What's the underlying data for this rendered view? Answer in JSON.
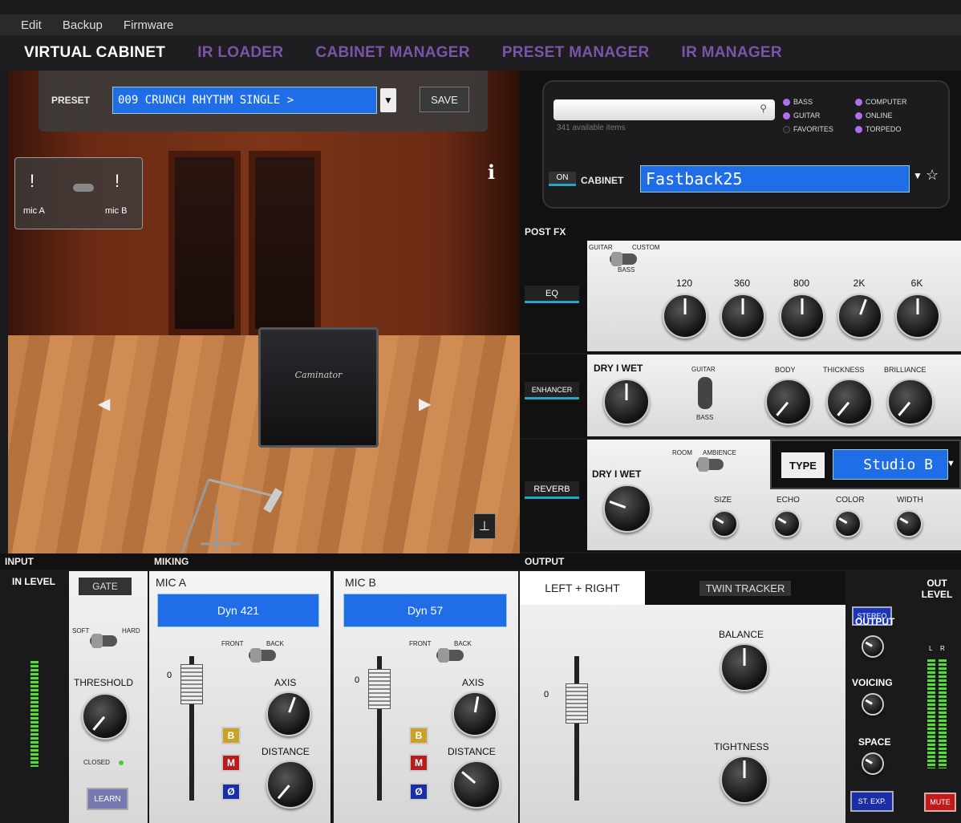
{
  "menu": [
    "Edit",
    "Backup",
    "Firmware"
  ],
  "tabs": [
    {
      "label": "VIRTUAL CABINET"
    },
    {
      "label": "IR LOADER"
    },
    {
      "label": "CABINET MANAGER"
    },
    {
      "label": "PRESET MANAGER"
    },
    {
      "label": "IR MANAGER"
    }
  ],
  "preset": {
    "label": "PRESET",
    "value": "009 CRUNCH RHYTHM SINGLE >",
    "save": "SAVE"
  },
  "scene": {
    "mic_a": "mic A",
    "mic_b": "mic B",
    "info": "i",
    "cab_brand": "Caminator"
  },
  "browser": {
    "search_placeholder": "",
    "available": "341 available items",
    "filters": [
      {
        "label": "BASS",
        "on": true
      },
      {
        "label": "COMPUTER",
        "on": true
      },
      {
        "label": "GUITAR",
        "on": true
      },
      {
        "label": "ONLINE",
        "on": true
      },
      {
        "label": "FAVORITES",
        "on": false
      },
      {
        "label": "TORPEDO",
        "on": true
      }
    ],
    "on_label": "ON",
    "cabinet_label": "CABINET",
    "cabinet_value": "Fastback25"
  },
  "postfx": {
    "title": "POST FX",
    "eq": {
      "label": "EQ",
      "guitar": "GUITAR",
      "custom": "CUSTOM",
      "bass": "BASS",
      "bands": [
        "120",
        "360",
        "800",
        "2K",
        "6K"
      ]
    },
    "enhancer": {
      "label": "ENHANCER",
      "drywet": "DRY I WET",
      "guitar": "GUITAR",
      "bass": "BASS",
      "body": "BODY",
      "thickness": "THICKNESS",
      "brilliance": "BRILLIANCE"
    },
    "reverb": {
      "label": "REVERB",
      "drywet": "DRY I WET",
      "room": "ROOM",
      "ambience": "AMBIENCE",
      "type_label": "TYPE",
      "type_value": "Studio B",
      "size": "SIZE",
      "echo": "ECHO",
      "color": "COLOR",
      "width": "WIDTH"
    }
  },
  "input": {
    "title": "INPUT",
    "in_level": "IN LEVEL",
    "gate": "GATE",
    "soft": "SOFT",
    "hard": "HARD",
    "threshold": "THRESHOLD",
    "closed": "CLOSED",
    "learn": "LEARN"
  },
  "miking": {
    "title": "MIKING",
    "mic_a": {
      "label": "MIC A",
      "mic": "Dyn 421",
      "front": "FRONT",
      "back": "BACK",
      "axis": "AXIS",
      "distance": "DISTANCE",
      "b": "B",
      "m": "M",
      "phase": "Ø",
      "zero": "0"
    },
    "mic_b": {
      "label": "MIC B",
      "mic": "Dyn 57",
      "front": "FRONT",
      "back": "BACK",
      "axis": "AXIS",
      "distance": "DISTANCE",
      "b": "B",
      "m": "M",
      "phase": "Ø",
      "zero": "0"
    }
  },
  "output": {
    "title": "OUTPUT",
    "left_right": "LEFT + RIGHT",
    "twin_tracker": "TWIN TRACKER",
    "balance": "BALANCE",
    "tightness": "TIGHTNESS",
    "zero": "0",
    "stereo": "STEREO",
    "output": "OUTPUT",
    "voicing": "VOICING",
    "space": "SPACE",
    "st_exp": "ST. EXP.",
    "mute": "MUTE",
    "out_level": "OUT LEVEL",
    "l": "L",
    "r": "R"
  }
}
